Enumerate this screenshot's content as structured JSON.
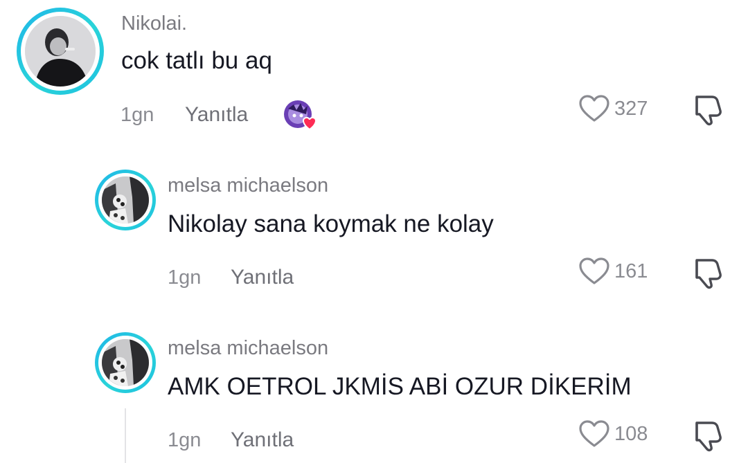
{
  "comments": [
    {
      "username": "Nikolai.",
      "text": "cok tatlı bu aq",
      "time": "1gn",
      "reply_label": "Yanıtla",
      "likes": "327",
      "has_creator_like": true
    },
    {
      "username": "melsa michaelson",
      "text": "Nikolay sana koymak ne kolay",
      "time": "1gn",
      "reply_label": "Yanıtla",
      "likes": "161"
    },
    {
      "username": "melsa michaelson",
      "text": "AMK OETROL JKMİS ABİ OZUR DİKERİM",
      "time": "1gn",
      "reply_label": "Yanıtla",
      "likes": "108"
    }
  ],
  "icons": {
    "like": "heart-outline-icon",
    "dislike": "thumbs-down-icon",
    "creator_like": "creator-liked-avatar-icon"
  },
  "colors": {
    "avatar_ring": "#1fb6e8",
    "text": "#161823",
    "muted": "#8a8b91",
    "heart_badge": "#fe2c55"
  }
}
